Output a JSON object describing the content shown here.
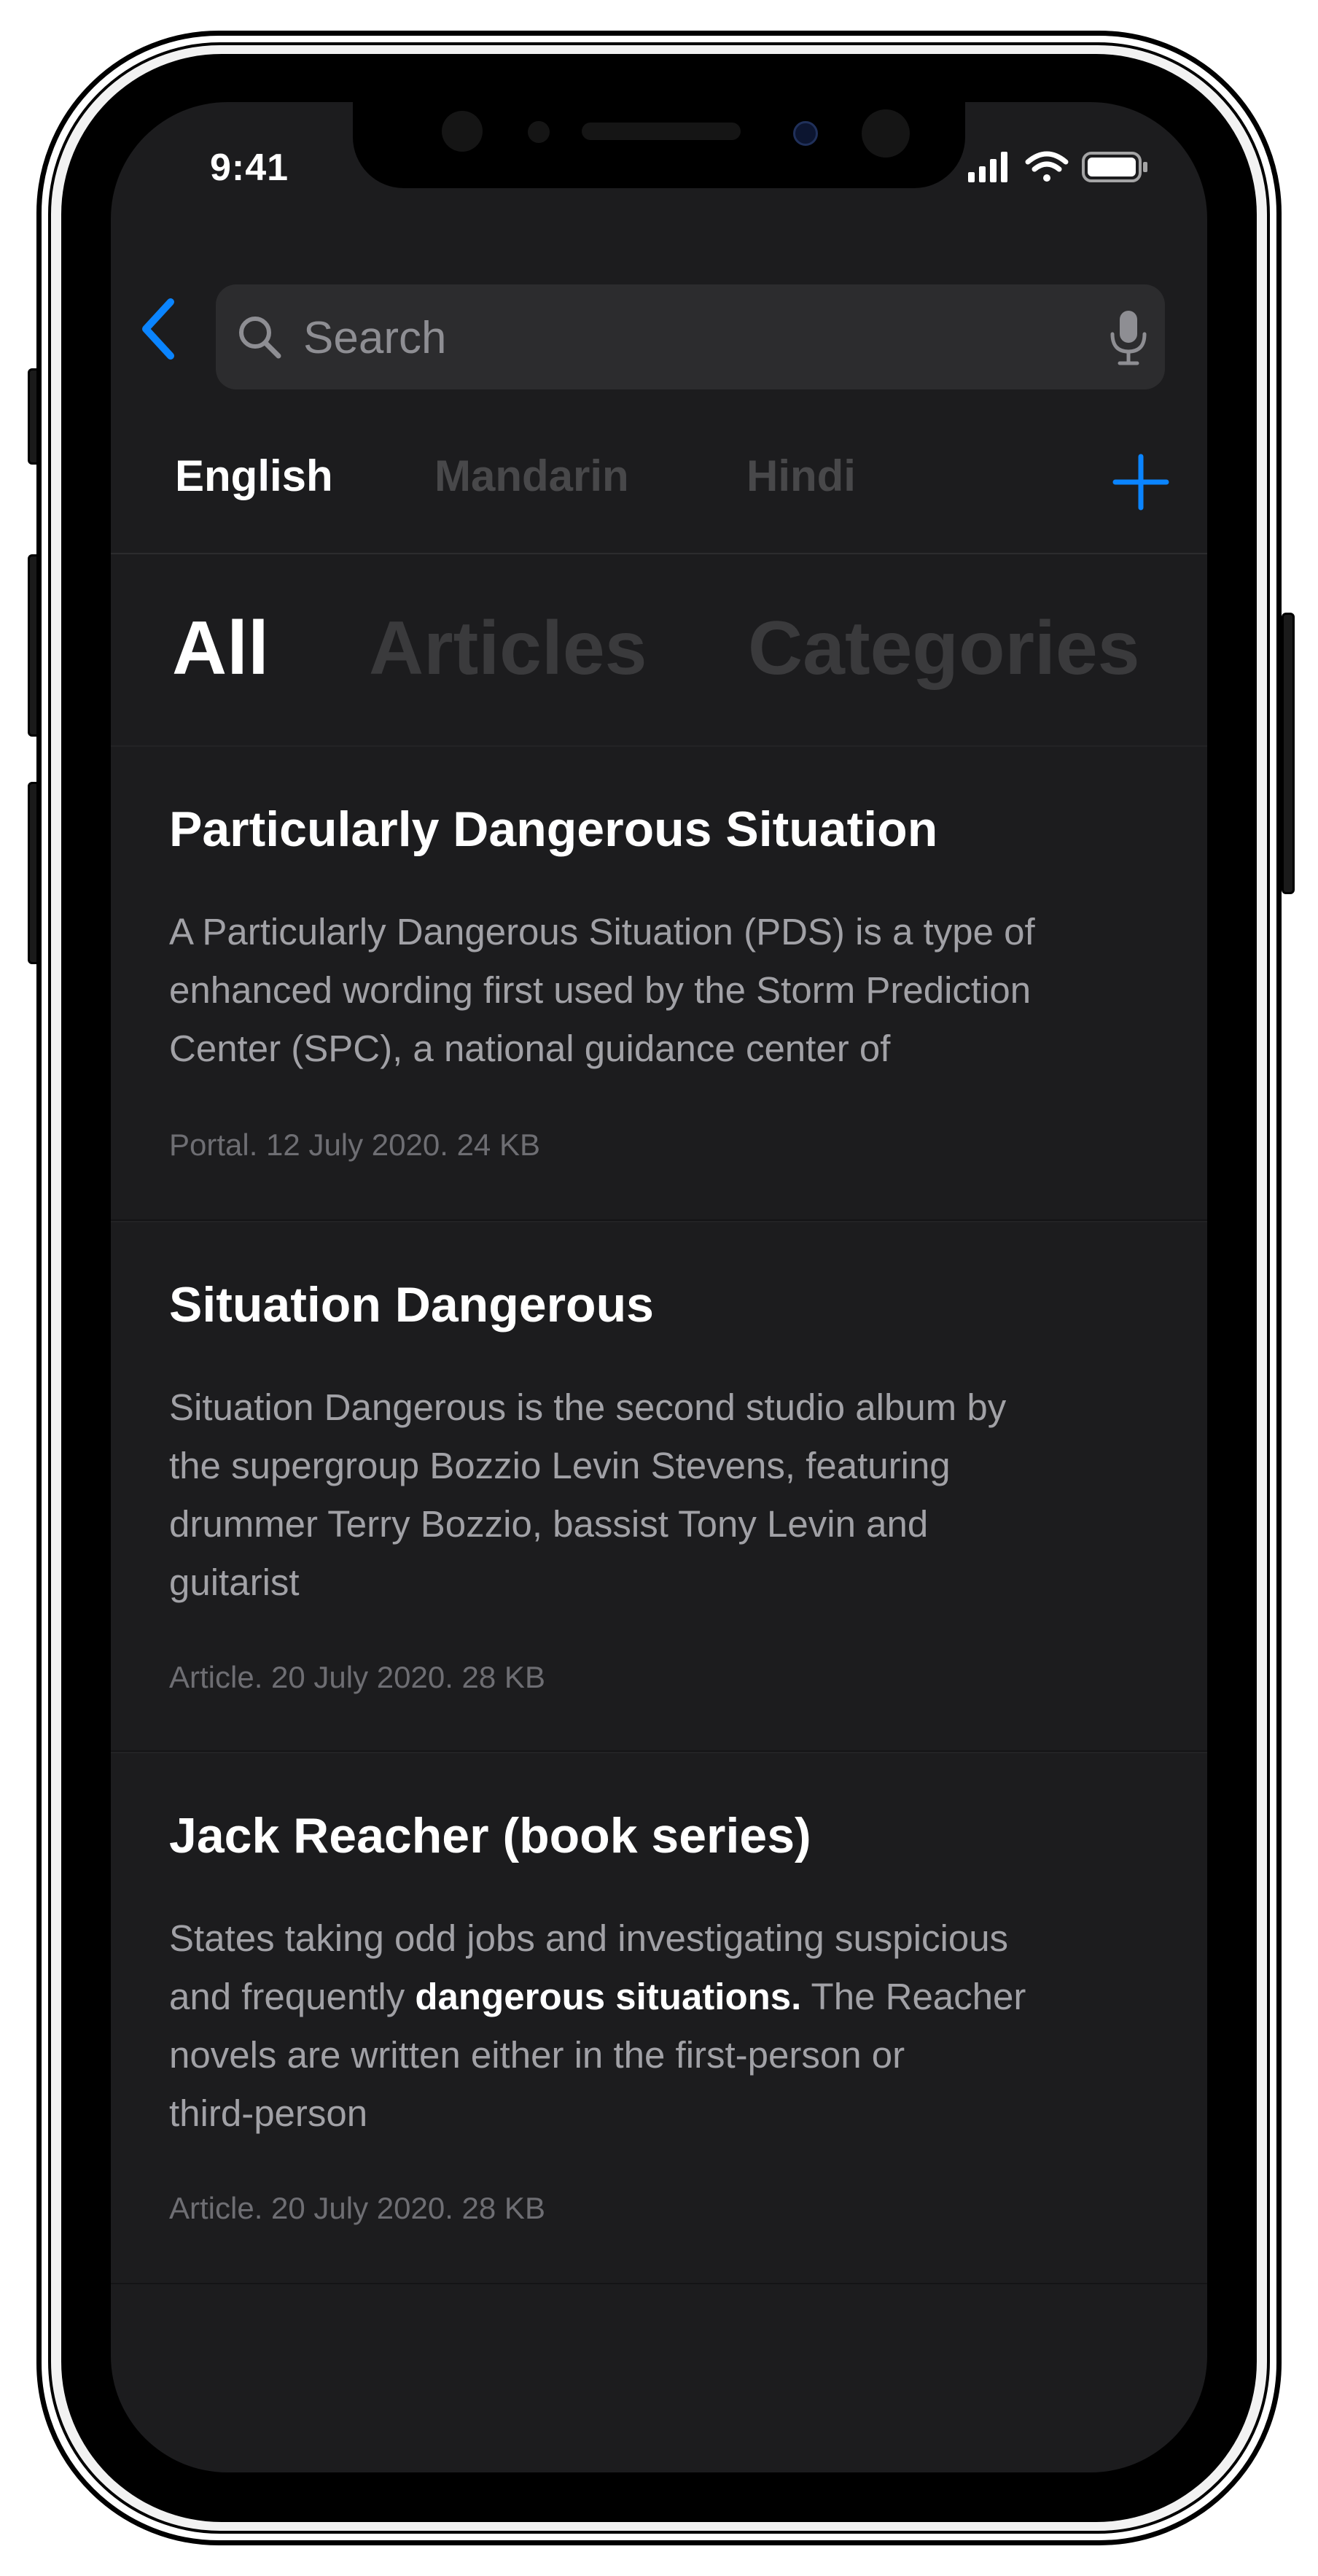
{
  "status_bar": {
    "time": "9:41",
    "icons": [
      "cellular-signal-icon",
      "wifi-icon",
      "battery-icon"
    ]
  },
  "search": {
    "back_icon": "chevron-left-icon",
    "placeholder": "Search",
    "value": "",
    "search_icon": "magnifier-icon",
    "mic_icon": "microphone-icon"
  },
  "languages": {
    "items": [
      {
        "label": "English",
        "active": true
      },
      {
        "label": "Mandarin",
        "active": false
      },
      {
        "label": "Hindi",
        "active": false
      }
    ],
    "add_icon": "plus-icon"
  },
  "filters": {
    "items": [
      {
        "label": "All",
        "active": true
      },
      {
        "label": "Articles",
        "active": false
      },
      {
        "label": "Categories",
        "active": false
      }
    ]
  },
  "results": [
    {
      "title": "Particularly Dangerous Situation",
      "snippet_lines": [
        "A Particularly Dangerous Situation (PDS) is a type of",
        "enhanced wording first used by the Storm Prediction",
        "Center (SPC), a national guidance center of"
      ],
      "meta": "Portal. 12 July 2020. 24 KB"
    },
    {
      "title": "Situation Dangerous",
      "snippet_lines": [
        "Situation Dangerous is the second studio album by",
        "the supergroup Bozzio Levin Stevens, featuring",
        "drummer Terry Bozzio, bassist Tony Levin and",
        "guitarist"
      ],
      "meta": "Article. 20 July 2020. 28 KB"
    },
    {
      "title": "Jack Reacher (book series)",
      "snippet_line1": "States taking odd jobs and investigating suspicious",
      "snippet_line2_before": "and frequently ",
      "snippet_highlight": "dangerous situations.",
      "snippet_line2_after": " The Reacher",
      "snippet_line3": "novels are written either in the first-person or",
      "snippet_line4": "third-person",
      "meta": "Article. 20 July 2020. 28 KB"
    }
  ],
  "colors": {
    "accent": "#0a84ff",
    "background": "#1c1c1e",
    "field": "#2c2c2e",
    "muted_text": "#a1a1a6"
  }
}
